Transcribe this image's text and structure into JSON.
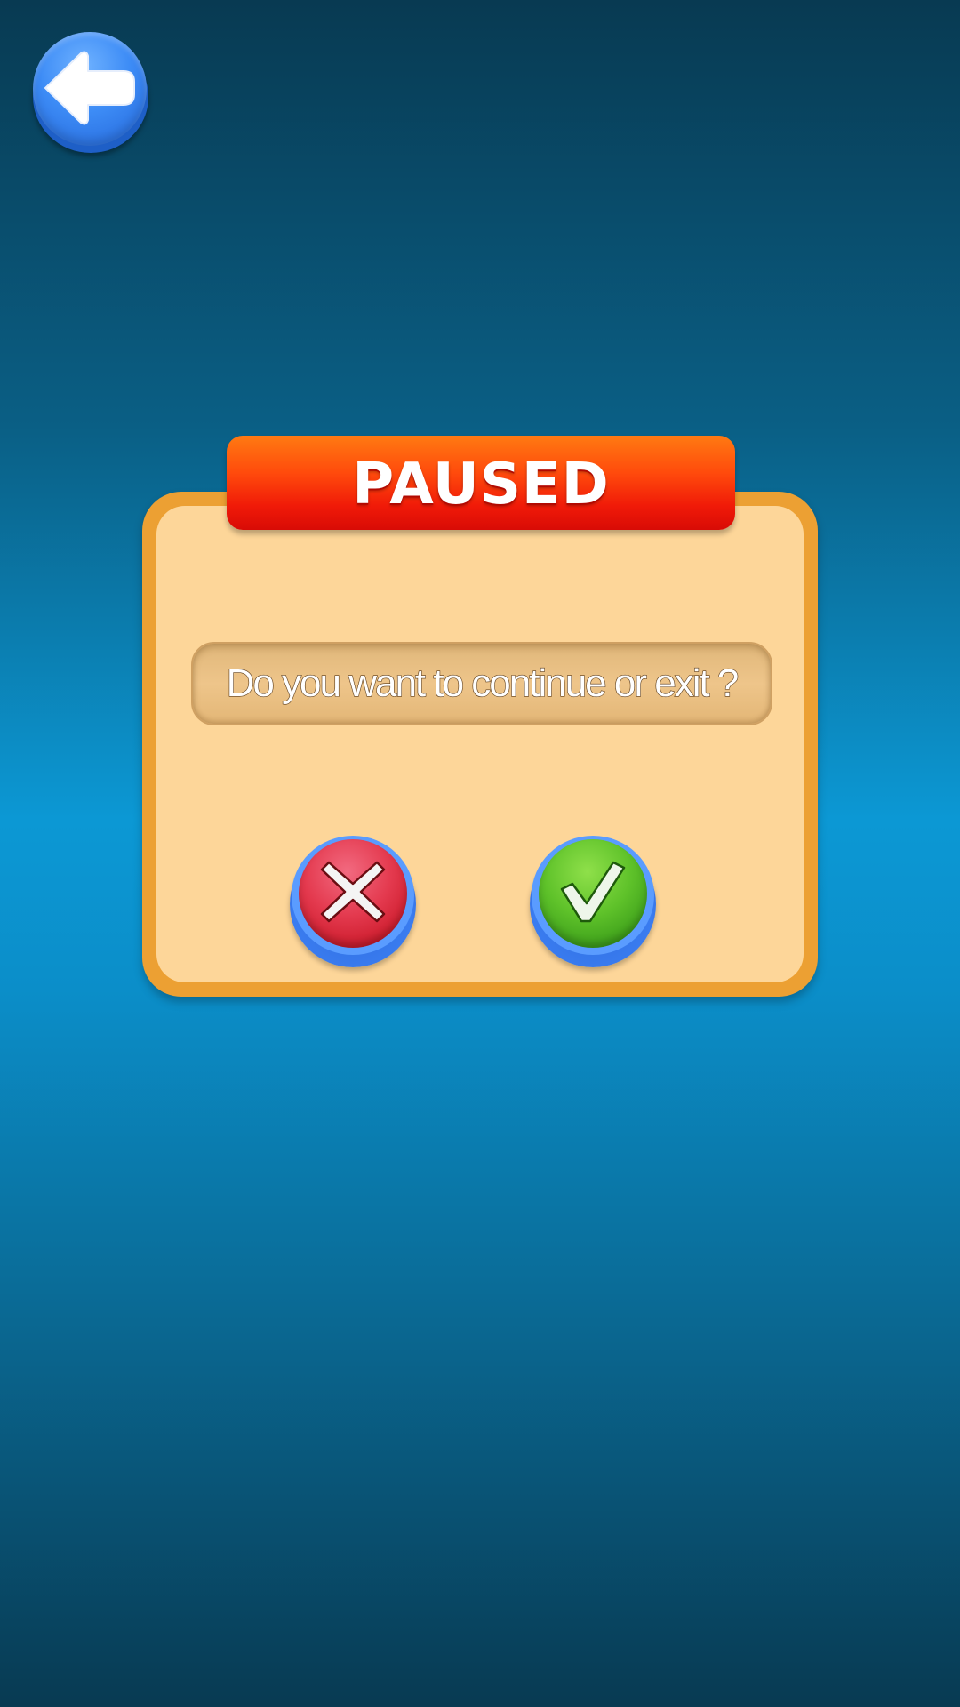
{
  "header": {
    "back_icon": "arrow-left-icon"
  },
  "dialog": {
    "title": "PAUSED",
    "message": "Do you want to continue or exit ?",
    "cancel_icon": "close-icon",
    "confirm_icon": "check-icon"
  },
  "colors": {
    "background": "#0c98d4",
    "dialog_border": "#eca033",
    "dialog_fill": "#fdd699",
    "title_banner": "#f01a08",
    "cancel": "#e43a4f",
    "confirm": "#5fc22a",
    "button_ring": "#3a7cf0"
  }
}
